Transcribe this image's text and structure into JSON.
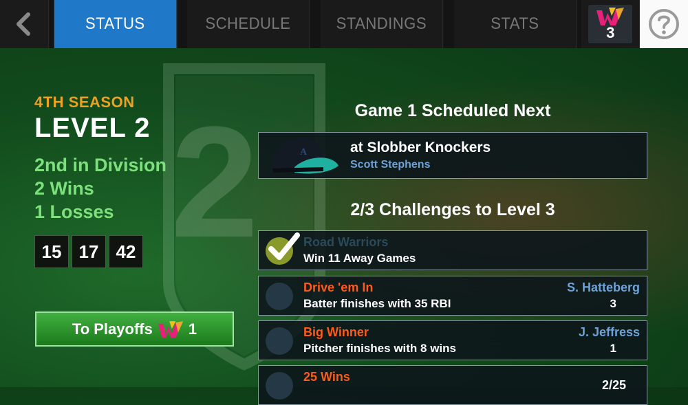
{
  "nav": {
    "tabs": [
      {
        "label": "STATUS",
        "active": true
      },
      {
        "label": "SCHEDULE",
        "active": false
      },
      {
        "label": "STANDINGS",
        "active": false
      },
      {
        "label": "STATS",
        "active": false
      }
    ],
    "tokens": "3",
    "help_icon": "question-circle-icon",
    "back_icon": "chevron-left-icon"
  },
  "season": {
    "label": "4TH SEASON",
    "level": "LEVEL 2",
    "background_number": "2",
    "division": "2nd in Division",
    "wins": "2 Wins",
    "losses": "1 Losses",
    "boxes": [
      "15",
      "17",
      "42"
    ]
  },
  "playoffs": {
    "label": "To Playoffs",
    "count": "1"
  },
  "next_game": {
    "heading": "Game 1 Scheduled Next",
    "opponent": "at Slobber Knockers",
    "pitcher": "Scott Stephens"
  },
  "challenges": {
    "heading": "2/3 Challenges to Level 3",
    "items": [
      {
        "title": "Road Warriors",
        "desc": "Win 11 Away Games",
        "player": "",
        "count": "",
        "done": true
      },
      {
        "title": "Drive 'em In",
        "desc": "Batter finishes with 35 RBI",
        "player": "S. Hatteberg",
        "count": "3",
        "done": false
      },
      {
        "title": "Big Winner",
        "desc": "Pitcher finishes with 8 wins",
        "player": "J. Jeffress",
        "count": "1",
        "done": false
      },
      {
        "title": "25 Wins",
        "desc": "",
        "player": "",
        "count": "2/25",
        "done": false
      }
    ]
  },
  "colors": {
    "active_tab": "#1f78c8",
    "season_label": "#f0a020",
    "record": "#7de07d",
    "challenge_title": "#ff5a1a",
    "player_name": "#6da2d8"
  }
}
